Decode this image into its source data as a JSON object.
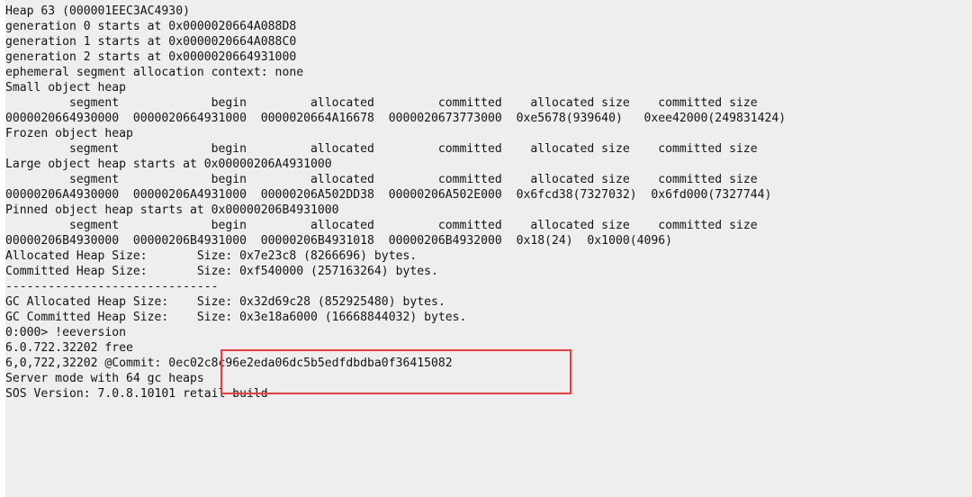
{
  "console": {
    "prompt": "0:000>",
    "background_color": "#eeeeee",
    "text_color": "#141414",
    "highlight_color": "#f6393a",
    "lines": [
      "Heap 63 (000001EEC3AC4930)",
      "generation 0 starts at 0x0000020664A088D8",
      "generation 1 starts at 0x0000020664A088C0",
      "generation 2 starts at 0x0000020664931000",
      "ephemeral segment allocation context: none",
      "Small object heap",
      "         segment             begin         allocated         committed    allocated size    committed size",
      "0000020664930000  0000020664931000  0000020664A16678  0000020673773000  0xe5678(939640)   0xee42000(249831424)",
      "Frozen object heap",
      "         segment             begin         allocated         committed    allocated size    committed size",
      "Large object heap starts at 0x00000206A4931000",
      "         segment             begin         allocated         committed    allocated size    committed size",
      "00000206A4930000  00000206A4931000  00000206A502DD38  00000206A502E000  0x6fcd38(7327032)  0x6fd000(7327744)",
      "Pinned object heap starts at 0x00000206B4931000",
      "         segment             begin         allocated         committed    allocated size    committed size",
      "00000206B4930000  00000206B4931000  00000206B4931018  00000206B4932000  0x18(24)  0x1000(4096)",
      "Allocated Heap Size:       Size: 0x7e23c8 (8266696) bytes.",
      "Committed Heap Size:       Size: 0xf540000 (257163264) bytes.",
      "------------------------------",
      "GC Allocated Heap Size:    Size: 0x32d69c28 (852925480) bytes.",
      "GC Committed Heap Size:    Size: 0x3e18a6000 (16668844032) bytes.",
      "0:000> !eeversion",
      "6.0.722.32202 free",
      "6,0,722,32202 @Commit: 0ec02c8c96e2eda06dc5b5edfdbdba0f36415082",
      "Server mode with 64 gc heaps",
      "SOS Version: 7.0.8.10101 retail build"
    ],
    "heap": {
      "heap_label": "Heap 63 (000001EEC3AC4930)",
      "heap_index": "63",
      "heap_address": "000001EEC3AC4930",
      "generations": [
        {
          "label": "generation 0 starts at",
          "address": "0x0000020664A088D8"
        },
        {
          "label": "generation 1 starts at",
          "address": "0x0000020664A088C0"
        },
        {
          "label": "generation 2 starts at",
          "address": "0x0000020664931000"
        }
      ],
      "ephemeral_segment_allocation_context": "none",
      "column_headers": [
        "segment",
        "begin",
        "allocated",
        "committed",
        "allocated size",
        "committed size"
      ],
      "sections": [
        {
          "title": "Small object heap",
          "rows": [
            {
              "segment": "0000020664930000",
              "begin": "0000020664931000",
              "allocated": "0000020664A16678",
              "committed": "0000020673773000",
              "allocated_size": "0xe5678(939640)",
              "committed_size": "0xee42000(249831424)"
            }
          ]
        },
        {
          "title": "Frozen object heap",
          "rows": []
        },
        {
          "title": "Large object heap starts at 0x00000206A4931000",
          "rows": [
            {
              "segment": "00000206A4930000",
              "begin": "00000206A4931000",
              "allocated": "00000206A502DD38",
              "committed": "00000206A502E000",
              "allocated_size": "0x6fcd38(7327032)",
              "committed_size": "0x6fd000(7327744)"
            }
          ]
        },
        {
          "title": "Pinned object heap starts at 0x00000206B4931000",
          "rows": [
            {
              "segment": "00000206B4930000",
              "begin": "00000206B4931000",
              "allocated": "00000206B4931018",
              "committed": "00000206B4932000",
              "allocated_size": "0x18(24)",
              "committed_size": "0x1000(4096)"
            }
          ]
        }
      ],
      "totals": [
        {
          "label": "Allocated Heap Size:",
          "size_text": "Size: 0x7e23c8 (8266696) bytes.",
          "hex": "0x7e23c8",
          "decimal": "8266696"
        },
        {
          "label": "Committed Heap Size:",
          "size_text": "Size: 0xf540000 (257163264) bytes.",
          "hex": "0xf540000",
          "decimal": "257163264"
        }
      ],
      "separator": "------------------------------",
      "gc_totals": [
        {
          "label": "GC Allocated Heap Size:",
          "size_text": "Size: 0x32d69c28 (852925480) bytes.",
          "hex": "0x32d69c28",
          "decimal": "852925480"
        },
        {
          "label": "GC Committed Heap Size:",
          "size_text": "Size: 0x3e18a6000 (16668844032) bytes.",
          "hex": "0x3e18a6000",
          "decimal": "16668844032"
        }
      ]
    },
    "eeversion": {
      "command": "0:000> !eeversion",
      "version": "6.0.722.32202 free",
      "commit": "6,0,722,32202 @Commit: 0ec02c8c96e2eda06dc5b5edfdbdba0f36415082",
      "gc_mode": "Server mode with 64 gc heaps",
      "sos_version": "SOS Version: 7.0.8.10101 retail build"
    }
  }
}
